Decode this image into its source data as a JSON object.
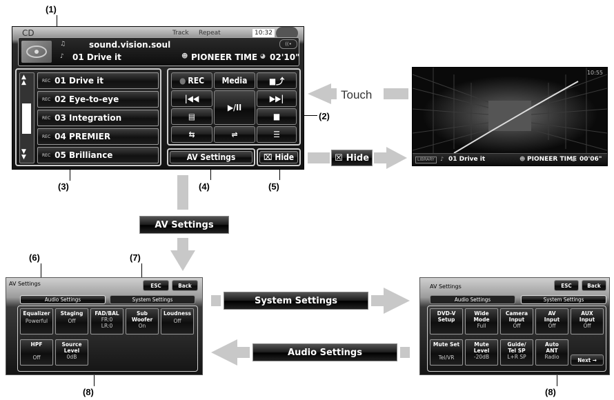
{
  "callouts": {
    "c1": "(1)",
    "c2": "(2)",
    "c3": "(3)",
    "c4": "(4)",
    "c5": "(5)",
    "c6": "(6)",
    "c7": "(7)",
    "c8a": "(8)",
    "c8b": "(8)"
  },
  "main": {
    "source": "CD",
    "track_label": "Track",
    "repeat_label": "Repeat",
    "clock": "10:32",
    "album": "sound.vision.soul",
    "track_name": "01 Drive it",
    "artist": "PIONEER TIME",
    "time": "02'10\"",
    "playlist": [
      "01 Drive it",
      "02 Eye-to-eye",
      "03 Integration",
      "04 PREMIER",
      "05 Brilliance"
    ],
    "rec_tag": "REC",
    "controls": {
      "rec": "REC",
      "media": "Media",
      "play": "▶/II"
    },
    "av_settings": "AV Settings",
    "hide": "Hide"
  },
  "touch_label": "Touch",
  "hide_label": "Hide",
  "av_settings_label": "AV Settings",
  "system_settings_label": "System Settings",
  "audio_settings_label": "Audio Settings",
  "hidden_screen": {
    "clock": "10:55",
    "library": "LIBRARY",
    "track": "01 Drive it",
    "artist": "PIONEER TIME",
    "time": "00'06\""
  },
  "audio_screen": {
    "title": "AV Settings",
    "esc": "ESC",
    "back": "Back",
    "tab_audio": "Audio Settings",
    "tab_system": "System Settings",
    "items": [
      {
        "name": "Equalizer",
        "value": "Powerful"
      },
      {
        "name": "Staging",
        "value": "Off"
      },
      {
        "name": "FAD/BAL",
        "value": "FR:0\nLR:0"
      },
      {
        "name": "Sub\nWoofer",
        "value": "On"
      },
      {
        "name": "Loudness",
        "value": "Off"
      },
      {
        "name": "HPF",
        "value": "Off"
      },
      {
        "name": "Source\nLevel",
        "value": "0dB"
      }
    ]
  },
  "system_screen": {
    "title": "AV Settings",
    "esc": "ESC",
    "back": "Back",
    "tab_audio": "Audio Settings",
    "tab_system": "System Settings",
    "items": [
      {
        "name": "DVD-V\nSetup",
        "value": ""
      },
      {
        "name": "Wide\nMode",
        "value": "Full"
      },
      {
        "name": "Camera\nInput",
        "value": "Off"
      },
      {
        "name": "AV\nInput",
        "value": "Off"
      },
      {
        "name": "AUX\nInput",
        "value": "Off"
      },
      {
        "name": "Mute Set",
        "value": "Tel/VR"
      },
      {
        "name": "Mute\nLevel",
        "value": "-20dB"
      },
      {
        "name": "Guide/\nTel SP",
        "value": "L+R SP"
      },
      {
        "name": "Auto\nANT",
        "value": "Radio"
      }
    ],
    "next": "Next →"
  }
}
